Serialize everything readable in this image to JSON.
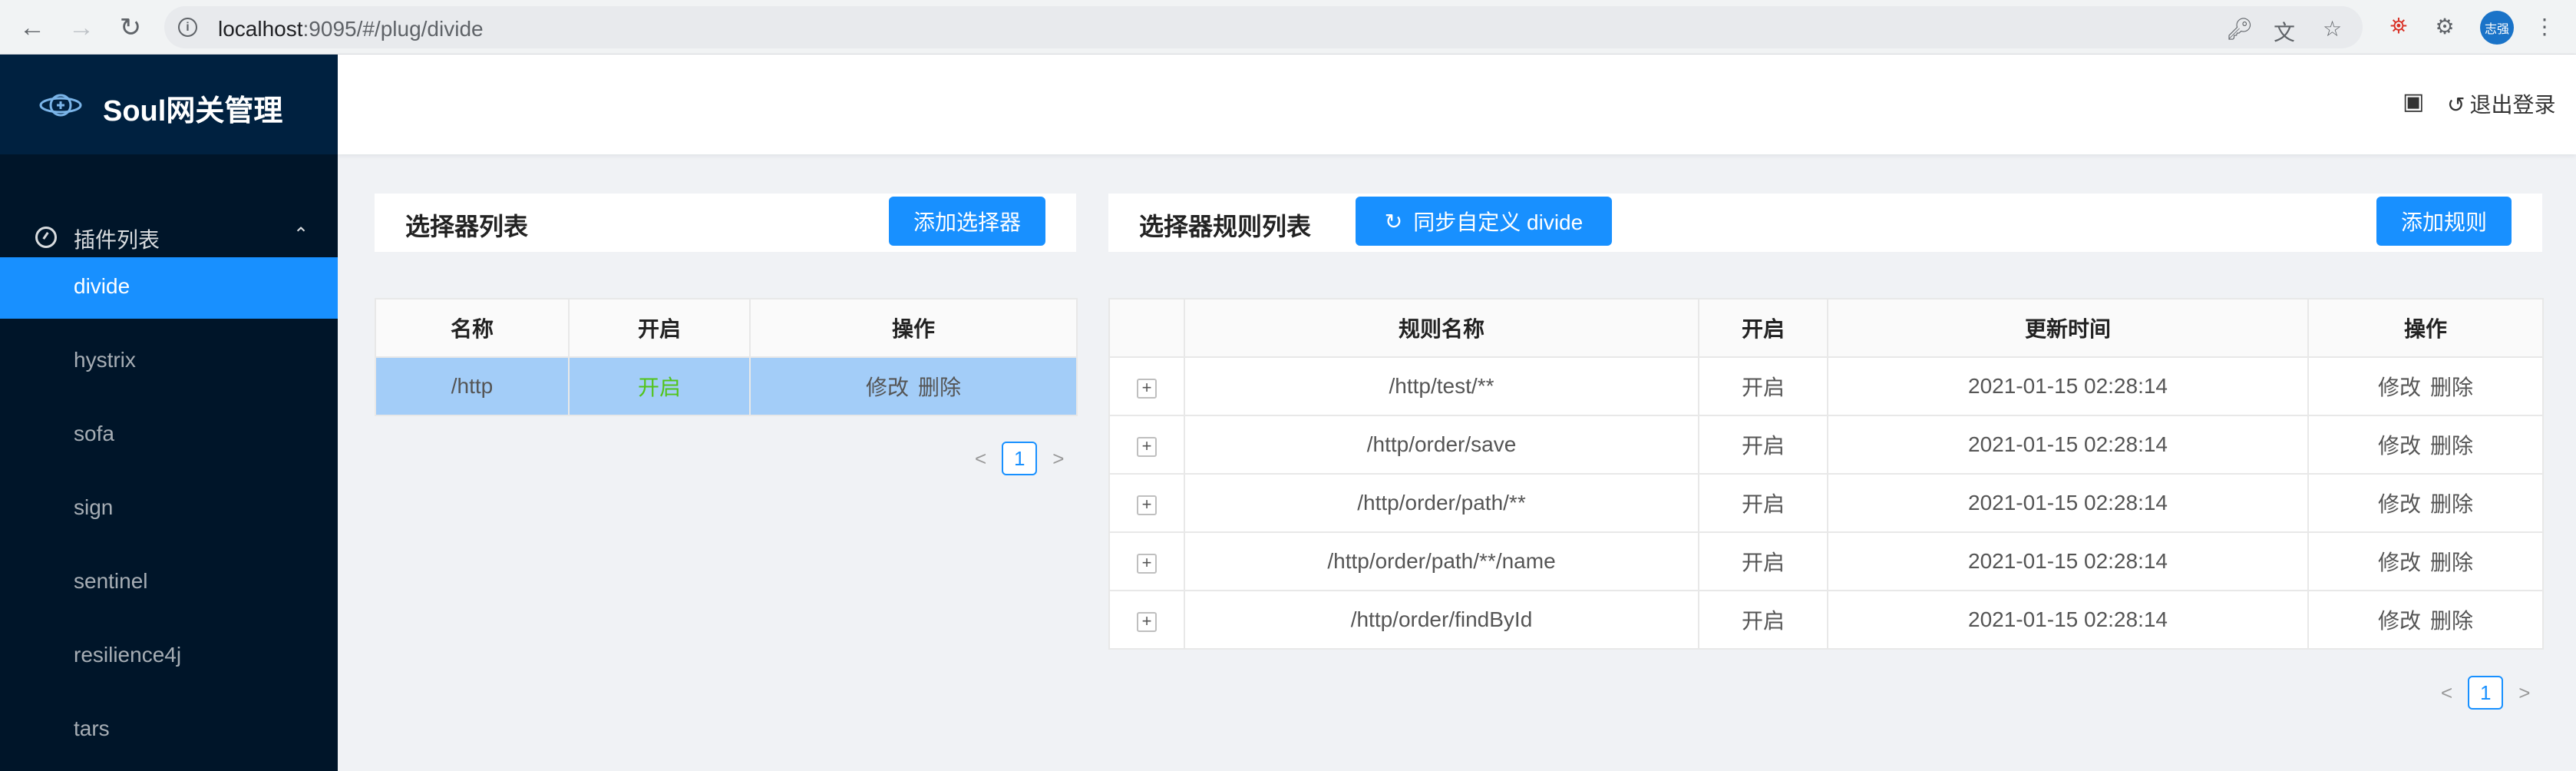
{
  "browser": {
    "url_host": "localhost",
    "url_rest": ":9095/#/plug/divide",
    "profile_label": "志强"
  },
  "app": {
    "title": "Soul网关管理"
  },
  "sidebar": {
    "group_label": "插件列表",
    "items": [
      {
        "label": "divide",
        "active": true
      },
      {
        "label": "hystrix"
      },
      {
        "label": "sofa"
      },
      {
        "label": "sign"
      },
      {
        "label": "sentinel"
      },
      {
        "label": "resilience4j"
      },
      {
        "label": "tars"
      }
    ]
  },
  "header": {
    "logout_label": "退出登录"
  },
  "selector_panel": {
    "title": "选择器列表",
    "add_button": "添加选择器",
    "columns": [
      "名称",
      "开启",
      "操作"
    ],
    "rows": [
      {
        "name": "/http",
        "enabled": "开启",
        "edit": "修改",
        "delete": "删除"
      }
    ],
    "page": "1"
  },
  "rule_panel": {
    "title": "选择器规则列表",
    "sync_button": "同步自定义 divide",
    "add_button": "添加规则",
    "columns": [
      "",
      "规则名称",
      "开启",
      "更新时间",
      "操作"
    ],
    "rows": [
      {
        "expand": "+",
        "name": "/http/test/**",
        "enabled": "开启",
        "updated": "2021-01-15 02:28:14",
        "edit": "修改",
        "delete": "删除"
      },
      {
        "expand": "+",
        "name": "/http/order/save",
        "enabled": "开启",
        "updated": "2021-01-15 02:28:14",
        "edit": "修改",
        "delete": "删除"
      },
      {
        "expand": "+",
        "name": "/http/order/path/**",
        "enabled": "开启",
        "updated": "2021-01-15 02:28:14",
        "edit": "修改",
        "delete": "删除"
      },
      {
        "expand": "+",
        "name": "/http/order/path/**/name",
        "enabled": "开启",
        "updated": "2021-01-15 02:28:14",
        "edit": "修改",
        "delete": "删除"
      },
      {
        "expand": "+",
        "name": "/http/order/findById",
        "enabled": "开启",
        "updated": "2021-01-15 02:28:14",
        "edit": "修改",
        "delete": "删除"
      }
    ],
    "page": "1"
  },
  "colors": {
    "primary": "#1890ff",
    "sidebar_bg": "#001529",
    "enabled_green": "#52c41a",
    "selected_row": "#a3cdf8"
  }
}
